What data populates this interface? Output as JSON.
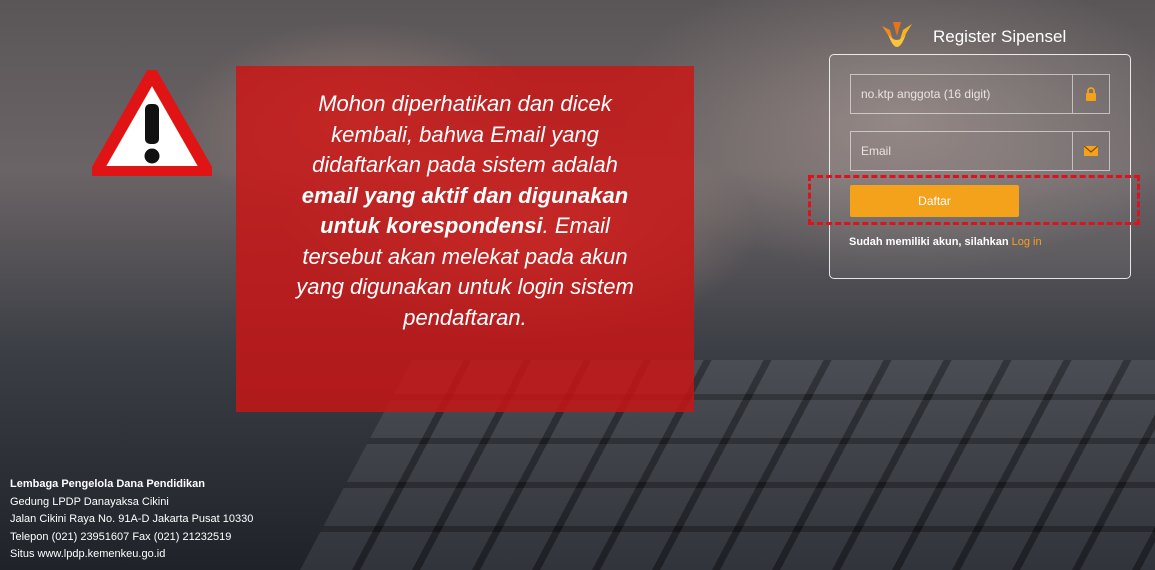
{
  "warning": {
    "line1": "Mohon diperhatikan dan dicek",
    "line2": "kembali, bahwa Email yang",
    "line3": "didaftarkan pada sistem adalah",
    "bold1": "email yang aktif dan digunakan",
    "bold2": "untuk korespondensi",
    "after_bold": ". Email",
    "line6": "tersebut akan melekat pada akun",
    "line7": "yang digunakan untuk login sistem",
    "line8": "pendaftaran."
  },
  "header": {
    "title": "Register Sipensel"
  },
  "form": {
    "ktp_placeholder": "no.ktp anggota (16 digit)",
    "email_placeholder": "Email",
    "submit_label": "Daftar",
    "login_prompt": "Sudah memiliki akun, silahkan",
    "login_link": "Log in"
  },
  "footer": {
    "org": "Lembaga Pengelola Dana Pendidikan",
    "building": "Gedung LPDP Danayaksa Cikini",
    "address": "Jalan Cikini Raya No. 91A-D Jakarta Pusat 10330",
    "phone": "Telepon (021) 23951607 Fax (021) 21232519",
    "site": "Situs www.lpdp.kemenkeu.go.id"
  },
  "colors": {
    "accent": "#f4a11c",
    "warning_red": "#cd1414",
    "highlight_dash": "#e0101c"
  },
  "icons": [
    "warning-triangle-icon",
    "lpdp-logo-icon",
    "lock-icon",
    "envelope-icon"
  ]
}
